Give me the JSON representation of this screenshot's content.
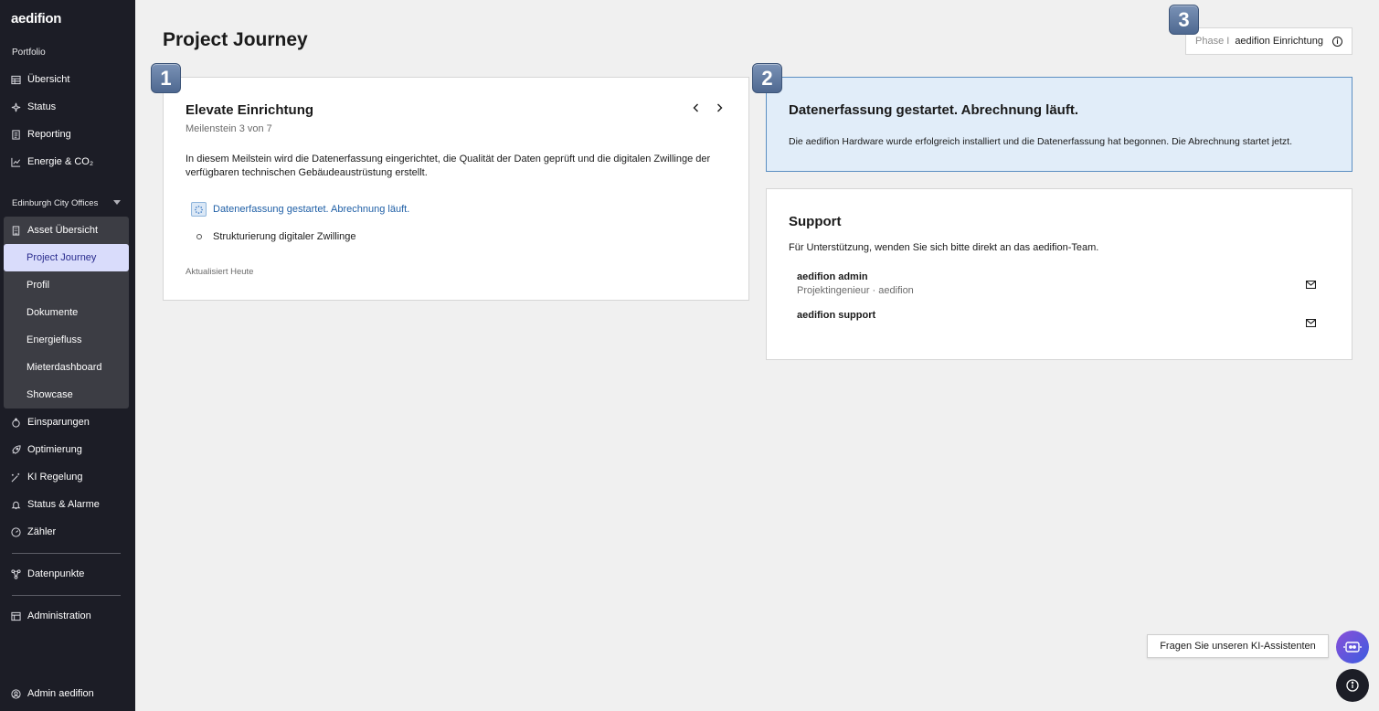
{
  "sidebar": {
    "logo": "aedifion",
    "portfolio_label": "Portfolio",
    "portfolio_items": [
      {
        "label": "Übersicht",
        "icon": "table-icon"
      },
      {
        "label": "Status",
        "icon": "sparkle-icon"
      },
      {
        "label": "Reporting",
        "icon": "document-icon"
      },
      {
        "label": "Energie & CO₂",
        "icon": "chart-icon"
      }
    ],
    "site_selector": "Edinburgh City Offices",
    "asset_overview": "Asset Übersicht",
    "asset_sub_items": [
      "Project Journey",
      "Profil",
      "Dokumente",
      "Energiefluss",
      "Mieterdashboard",
      "Showcase"
    ],
    "active_item": "Project Journey",
    "more_items": [
      {
        "label": "Einsparungen",
        "icon": "savings-icon"
      },
      {
        "label": "Optimierung",
        "icon": "rocket-icon"
      },
      {
        "label": "KI Regelung",
        "icon": "magic-wand-icon"
      },
      {
        "label": "Status & Alarme",
        "icon": "bell-icon"
      },
      {
        "label": "Zähler",
        "icon": "meter-icon"
      }
    ],
    "datapoints": "Datenpunkte",
    "administration": "Administration",
    "user": "Admin aedifion"
  },
  "header": {
    "title": "Project Journey",
    "phase_label": "Phase I",
    "phase_value": "aedifion Einrichtung"
  },
  "badges": [
    "1",
    "2",
    "3"
  ],
  "milestone_card": {
    "title": "Elevate Einrichtung",
    "subtitle": "Meilenstein 3 von 7",
    "description": "In diesem Meilstein wird die Datenerfassung eingerichtet, die Qualität der Daten geprüft und die digitalen Zwillinge der verfügbaren technischen Gebäudeaustrüstung erstellt.",
    "steps": [
      {
        "label": "Datenerfassung gestartet. Abrechnung läuft.",
        "state": "current"
      },
      {
        "label": "Strukturierung digitaler Zwillinge",
        "state": "pending"
      }
    ],
    "updated": "Aktualisiert Heute"
  },
  "status_card": {
    "title": "Datenerfassung gestartet. Abrechnung läuft.",
    "text": "Die aedifion Hardware wurde erfolgreich installiert und die Datenerfassung hat begonnen. Die Abrechnung startet jetzt."
  },
  "support_card": {
    "title": "Support",
    "text": "Für Unterstützung, wenden Sie sich bitte direkt an das aedifion-Team.",
    "contacts": [
      {
        "name": "aedifion admin",
        "role": "Projektingenieur · aedifion"
      },
      {
        "name": "aedifion support",
        "role": ""
      }
    ]
  },
  "assistant": {
    "label": "Fragen Sie unseren KI-Assistenten"
  },
  "colors": {
    "sidebar_bg": "#1c1d26",
    "active_bg": "#d9dcfb",
    "status_card_bg": "#e1edf9",
    "status_card_border": "#5b8ec2",
    "link_blue": "#1f5fa6"
  }
}
